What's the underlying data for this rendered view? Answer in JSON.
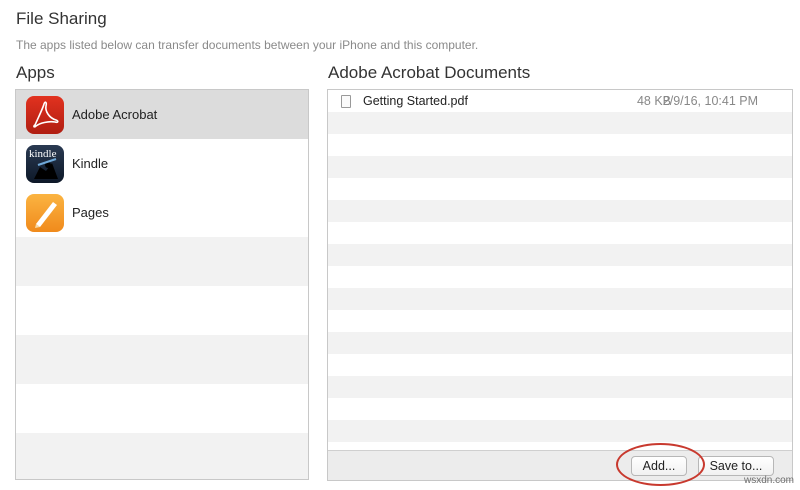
{
  "header": {
    "title": "File Sharing",
    "description": "The apps listed below can transfer documents between your iPhone and this computer."
  },
  "apps": {
    "label": "Apps",
    "items": [
      {
        "name": "Adobe Acrobat",
        "icon": "adobe-acrobat-icon",
        "selected": true
      },
      {
        "name": "Kindle",
        "icon": "kindle-icon",
        "icon_text": "kindle",
        "selected": false
      },
      {
        "name": "Pages",
        "icon": "pages-icon",
        "selected": false
      }
    ]
  },
  "documents": {
    "label": "Adobe Acrobat Documents",
    "files": [
      {
        "name": "Getting Started.pdf",
        "size": "48 KB",
        "date": "2/9/16, 10:41 PM",
        "icon": "pdf-file-icon"
      }
    ],
    "add_label": "Add...",
    "save_label": "Save to..."
  },
  "colors": {
    "selection": "#dcdcdc",
    "highlight_ring": "#c8392e",
    "stripe": "#f2f2f2"
  },
  "watermark": "wsxdn.com"
}
